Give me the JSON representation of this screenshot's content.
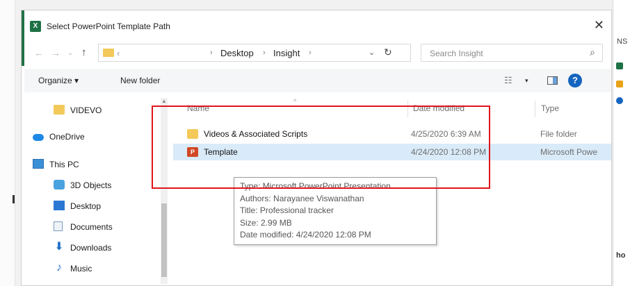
{
  "window": {
    "title": "Select PowerPoint Template Path",
    "close_glyph": "✕",
    "app_icon_glyph": "X"
  },
  "address_bar": {
    "hidden_segment": "‹",
    "crumbs": [
      "Desktop",
      "Insight"
    ],
    "separator": "›",
    "dropdown_glyph": "⌄",
    "refresh_glyph": "↻"
  },
  "navigation": {
    "back_glyph": "←",
    "forward_glyph": "→",
    "recent_glyph": "⌄",
    "up_glyph": "↑"
  },
  "search": {
    "placeholder": "Search Insight",
    "icon_glyph": "⌕"
  },
  "toolbar": {
    "organize_label": "Organize ▾",
    "new_folder_label": "New folder",
    "view_glyph": "☷",
    "view_caret": "▾",
    "help_glyph": "?"
  },
  "nav_pane": {
    "items": [
      {
        "label": "VIDEVO",
        "icon": "folder-icon"
      },
      {
        "label": "OneDrive",
        "icon": "onedrive-cloud-icon"
      },
      {
        "label": "This PC",
        "icon": "pc-icon"
      },
      {
        "label": "3D Objects",
        "icon": "3d-objects-icon"
      },
      {
        "label": "Desktop",
        "icon": "desktop-icon"
      },
      {
        "label": "Documents",
        "icon": "documents-icon"
      },
      {
        "label": "Downloads",
        "icon": "downloads-icon"
      },
      {
        "label": "Music",
        "icon": "music-icon"
      }
    ],
    "download_glyph": "⬇",
    "music_glyph": "♪",
    "scroll_up_glyph": "▲"
  },
  "file_list": {
    "columns": {
      "name": "Name",
      "date_modified": "Date modified",
      "type": "Type"
    },
    "sort_caret": "^",
    "rows": [
      {
        "name": "Videos & Associated Scripts",
        "date": "4/25/2020 6:39 AM",
        "type": "File folder",
        "icon": "folder-icon"
      },
      {
        "name": "Template",
        "date": "4/24/2020 12:08 PM",
        "type": "Microsoft Powe",
        "icon": "powerpoint-file-icon",
        "icon_glyph": "P"
      }
    ]
  },
  "tooltip": {
    "lines": [
      "Type: Microsoft PowerPoint Presentation",
      "Authors: Narayanee Viswanathan",
      "Title: Professional tracker",
      "Size: 2.99 MB",
      "Date modified: 4/24/2020 12:08 PM"
    ]
  },
  "background_window": {
    "snippets": [
      "NS",
      "ho"
    ]
  },
  "colors": {
    "highlight_box": "#e0141b",
    "selected_row": "#d9ebf9",
    "help_icon": "#1565c0",
    "excel_green": "#217346",
    "powerpoint_red": "#d24726"
  }
}
